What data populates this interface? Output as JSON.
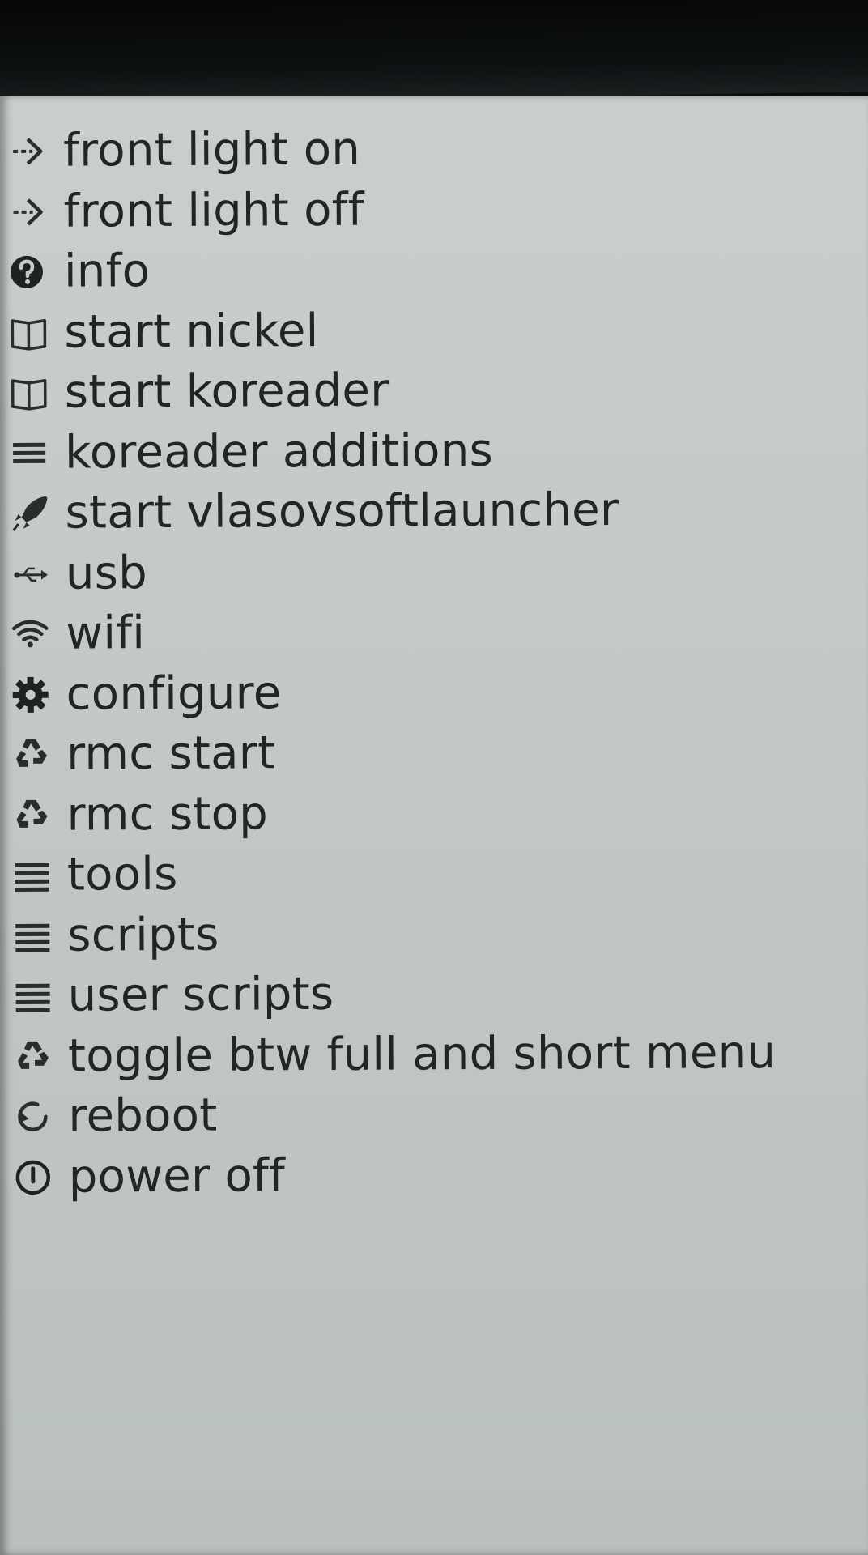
{
  "menu": {
    "items": [
      {
        "label": "front light on",
        "icon": "arrow-right-icon"
      },
      {
        "label": "front light off",
        "icon": "arrow-right-icon"
      },
      {
        "label": "info",
        "icon": "question-circle-icon"
      },
      {
        "label": "start nickel",
        "icon": "book-icon"
      },
      {
        "label": "start koreader",
        "icon": "book-icon"
      },
      {
        "label": "koreader additions",
        "icon": "list-icon"
      },
      {
        "label": "start vlasovsoftlauncher",
        "icon": "rocket-icon"
      },
      {
        "label": "usb",
        "icon": "usb-icon"
      },
      {
        "label": "wifi",
        "icon": "wifi-icon"
      },
      {
        "label": "configure",
        "icon": "gear-icon"
      },
      {
        "label": "rmc start",
        "icon": "recycle-icon"
      },
      {
        "label": "rmc stop",
        "icon": "recycle-icon"
      },
      {
        "label": "tools",
        "icon": "list-icon"
      },
      {
        "label": "scripts",
        "icon": "list-icon"
      },
      {
        "label": "user scripts",
        "icon": "list-icon"
      },
      {
        "label": "toggle btw full and short menu",
        "icon": "recycle-icon"
      },
      {
        "label": "reboot",
        "icon": "refresh-icon"
      },
      {
        "label": "power off",
        "icon": "power-icon"
      }
    ]
  }
}
